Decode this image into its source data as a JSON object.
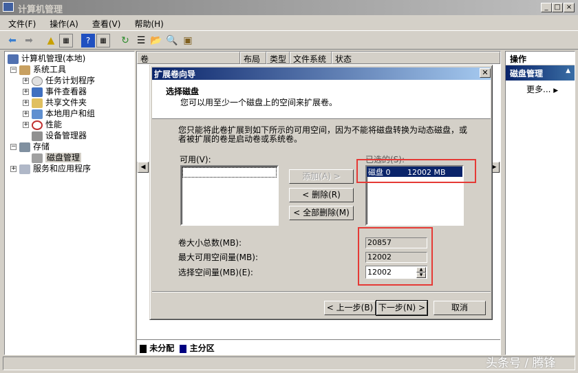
{
  "window": {
    "title": "计算机管理",
    "controls": [
      "_",
      "□",
      "×"
    ]
  },
  "menu": [
    "文件(F)",
    "操作(A)",
    "查看(V)",
    "帮助(H)"
  ],
  "tree": {
    "root": "计算机管理(本地)",
    "items": [
      {
        "label": "系统工具",
        "level": 1,
        "expander": "⊟"
      },
      {
        "label": "任务计划程序",
        "level": 2,
        "expander": "+"
      },
      {
        "label": "事件查看器",
        "level": 2,
        "expander": "+"
      },
      {
        "label": "共享文件夹",
        "level": 2,
        "expander": "+"
      },
      {
        "label": "本地用户和组",
        "level": 2,
        "expander": "+"
      },
      {
        "label": "性能",
        "level": 2,
        "expander": "+"
      },
      {
        "label": "设备管理器",
        "level": 2,
        "expander": ""
      },
      {
        "label": "存储",
        "level": 1,
        "expander": "⊟"
      },
      {
        "label": "磁盘管理",
        "level": 2,
        "expander": "",
        "selected": true
      },
      {
        "label": "服务和应用程序",
        "level": 1,
        "expander": "+"
      }
    ]
  },
  "columns": [
    "卷",
    "布局",
    "类型",
    "文件系统",
    "状态"
  ],
  "legend": {
    "unallocated": "未分配",
    "primary": "主分区",
    "unallocated_color": "#000000",
    "primary_color": "#000080"
  },
  "actions": {
    "header": "操作",
    "section": "磁盘管理",
    "more": "更多..."
  },
  "dialog": {
    "title": "扩展卷向导",
    "heading": "选择磁盘",
    "subheading": "您可以用至少一个磁盘上的空间来扩展卷。",
    "description": "您只能将此卷扩展到如下所示的可用空间，因为不能将磁盘转换为动态磁盘，或者被扩展的卷是启动卷或系统卷。",
    "available_label": "可用(V):",
    "selected_label": "已选的(S):",
    "selected_items": [
      {
        "disk": "磁盘 0",
        "size": "12002 MB"
      }
    ],
    "add_button": "添加(A) >",
    "remove_button": "< 删除(R)",
    "remove_all_button": "< 全部删除(M)",
    "total_label": "卷大小总数(MB):",
    "total_value": "20857",
    "max_label": "最大可用空间量(MB):",
    "max_value": "12002",
    "select_label": "选择空间量(MB)(E):",
    "select_value": "12002",
    "back_button": "< 上一步(B)",
    "next_button": "下一步(N) >",
    "cancel_button": "取消"
  },
  "watermark": "头条号 / 腾锋"
}
